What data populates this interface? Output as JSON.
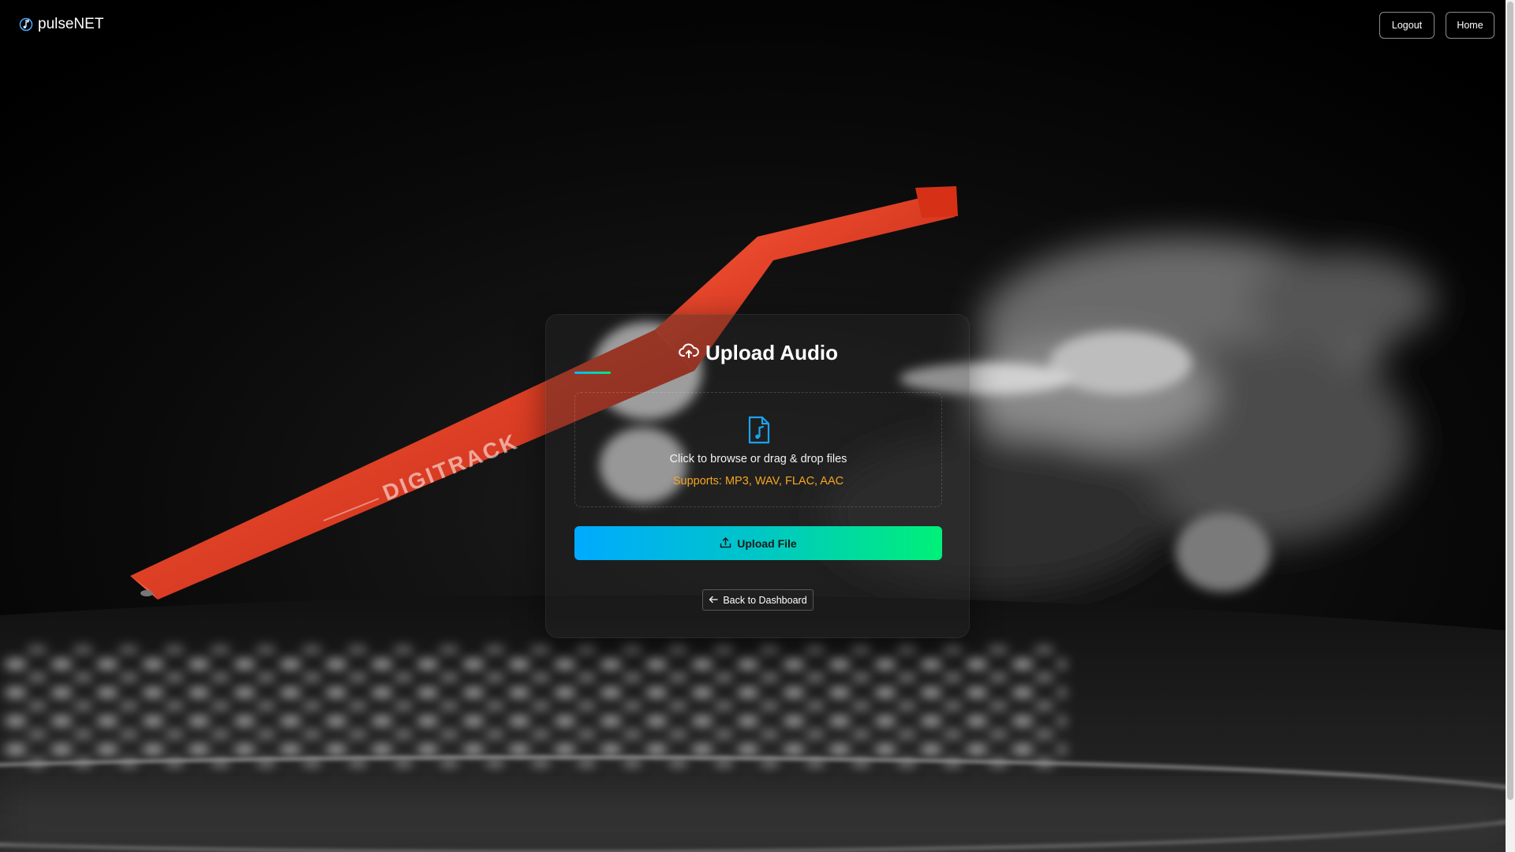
{
  "brand": {
    "name": "pulseNET",
    "icon": "music-note-icon"
  },
  "nav": {
    "logout_label": "Logout",
    "home_label": "Home"
  },
  "upload_card": {
    "title": "Upload Audio",
    "title_icon": "cloud-upload-icon",
    "dropzone": {
      "icon": "audio-file-icon",
      "prompt": "Click to browse or drag & drop files",
      "formats": "Supports: MP3, WAV, FLAC, AAC"
    },
    "upload_button": {
      "label": "Upload File",
      "icon": "upload-icon"
    },
    "back_button": {
      "label": "Back to Dashboard",
      "icon": "arrow-left-icon"
    }
  },
  "colors": {
    "accent_blue": "#00aaff",
    "accent_green": "#00f078",
    "formats_text": "#f5a623",
    "tonearm_red": "#e8391c"
  }
}
